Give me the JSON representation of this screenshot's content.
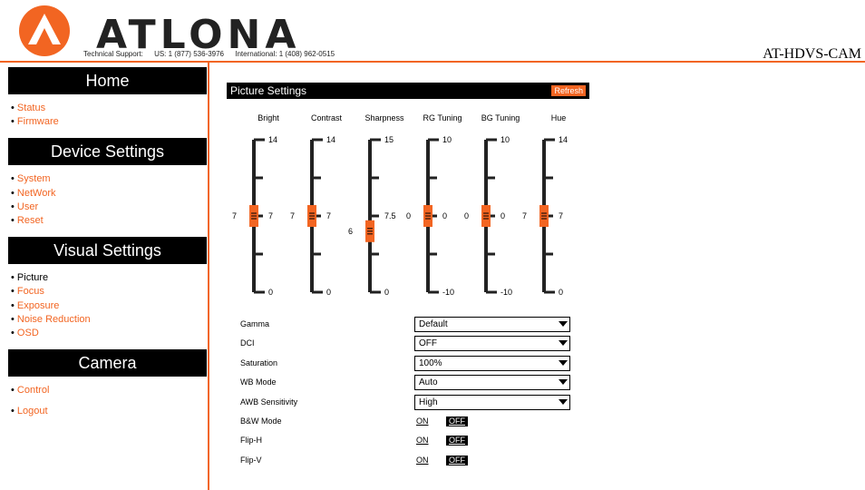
{
  "header": {
    "brand": "ATLONA",
    "support_label": "Technical Support:",
    "support_us": "US: 1 (877) 536-3976",
    "support_intl": "International: 1 (408) 962-0515",
    "model": "AT-HDVS-CAM",
    "accent_color": "#f26522"
  },
  "sidebar": {
    "sections": [
      {
        "title": "Home",
        "items": [
          {
            "label": "Status",
            "active": false
          },
          {
            "label": "Firmware",
            "active": false
          }
        ]
      },
      {
        "title": "Device Settings",
        "items": [
          {
            "label": "System",
            "active": false
          },
          {
            "label": "NetWork",
            "active": false
          },
          {
            "label": "User",
            "active": false
          },
          {
            "label": "Reset",
            "active": false
          }
        ]
      },
      {
        "title": "Visual Settings",
        "items": [
          {
            "label": "Picture",
            "active": true
          },
          {
            "label": "Focus",
            "active": false
          },
          {
            "label": "Exposure",
            "active": false
          },
          {
            "label": "Noise Reduction",
            "active": false
          },
          {
            "label": "OSD",
            "active": false
          }
        ]
      },
      {
        "title": "Camera",
        "items": [
          {
            "label": "Control",
            "active": false
          },
          {
            "label": "Logout",
            "active": false
          }
        ]
      }
    ]
  },
  "panel": {
    "title": "Picture Settings",
    "refresh_label": "Refresh"
  },
  "sliders": [
    {
      "label": "Bright",
      "min": 0,
      "max": 14,
      "value": 7,
      "max_label": "14",
      "mid_label": "7",
      "min_label": "0",
      "value_label": "7"
    },
    {
      "label": "Contrast",
      "min": 0,
      "max": 14,
      "value": 7,
      "max_label": "14",
      "mid_label": "7",
      "min_label": "0",
      "value_label": "7"
    },
    {
      "label": "Sharpness",
      "min": 0,
      "max": 15,
      "value": 6,
      "max_label": "15",
      "mid_label": "7.5",
      "min_label": "0",
      "value_label": "6"
    },
    {
      "label": "RG Tuning",
      "min": -10,
      "max": 10,
      "value": 0,
      "max_label": "10",
      "mid_label": "0",
      "min_label": "-10",
      "value_label": "0"
    },
    {
      "label": "BG Tuning",
      "min": -10,
      "max": 10,
      "value": 0,
      "max_label": "10",
      "mid_label": "0",
      "min_label": "-10",
      "value_label": "0"
    },
    {
      "label": "Hue",
      "min": 0,
      "max": 14,
      "value": 7,
      "max_label": "14",
      "mid_label": "7",
      "min_label": "0",
      "value_label": "7"
    }
  ],
  "selects": [
    {
      "label": "Gamma",
      "value": "Default"
    },
    {
      "label": "DCI",
      "value": "OFF"
    },
    {
      "label": "Saturation",
      "value": "100%"
    },
    {
      "label": "WB Mode",
      "value": "Auto"
    },
    {
      "label": "AWB Sensitivity",
      "value": "High"
    }
  ],
  "toggles": [
    {
      "label": "B&W Mode",
      "on_label": "ON",
      "off_label": "OFF",
      "state": "OFF"
    },
    {
      "label": "Flip-H",
      "on_label": "ON",
      "off_label": "OFF",
      "state": "OFF"
    },
    {
      "label": "Flip-V",
      "on_label": "ON",
      "off_label": "OFF",
      "state": "OFF"
    }
  ]
}
